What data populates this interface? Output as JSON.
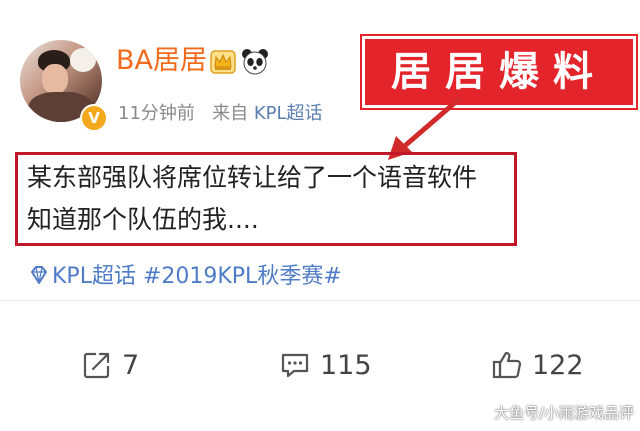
{
  "post": {
    "username": "BA居居",
    "time": "11分钟前",
    "source_prefix": "来自",
    "source": "KPL超话",
    "badge": "V",
    "text_line1": "某东部强队将席位转让给了一个语音软件",
    "text_line2": "知道那个队伍的我....",
    "topics": "KPL超话 #2019KPL秋季赛#",
    "icons": {
      "crown": "crown-icon",
      "panda": "panda-icon",
      "topic": "diamond-icon"
    }
  },
  "callout": {
    "text": "居居爆料",
    "color": "#e3242b"
  },
  "actions": {
    "repost_count": "7",
    "comment_count": "115",
    "like_count": "122",
    "icons": {
      "repost": "share-icon",
      "comment": "comment-icon",
      "like": "thumbs-up-icon"
    }
  },
  "watermark": "大鱼号/小雨游戏品评",
  "colors": {
    "username": "#f26b1d",
    "link": "#4f7cc6",
    "highlight_border": "#c0182a",
    "background": "#f1f1f1"
  }
}
